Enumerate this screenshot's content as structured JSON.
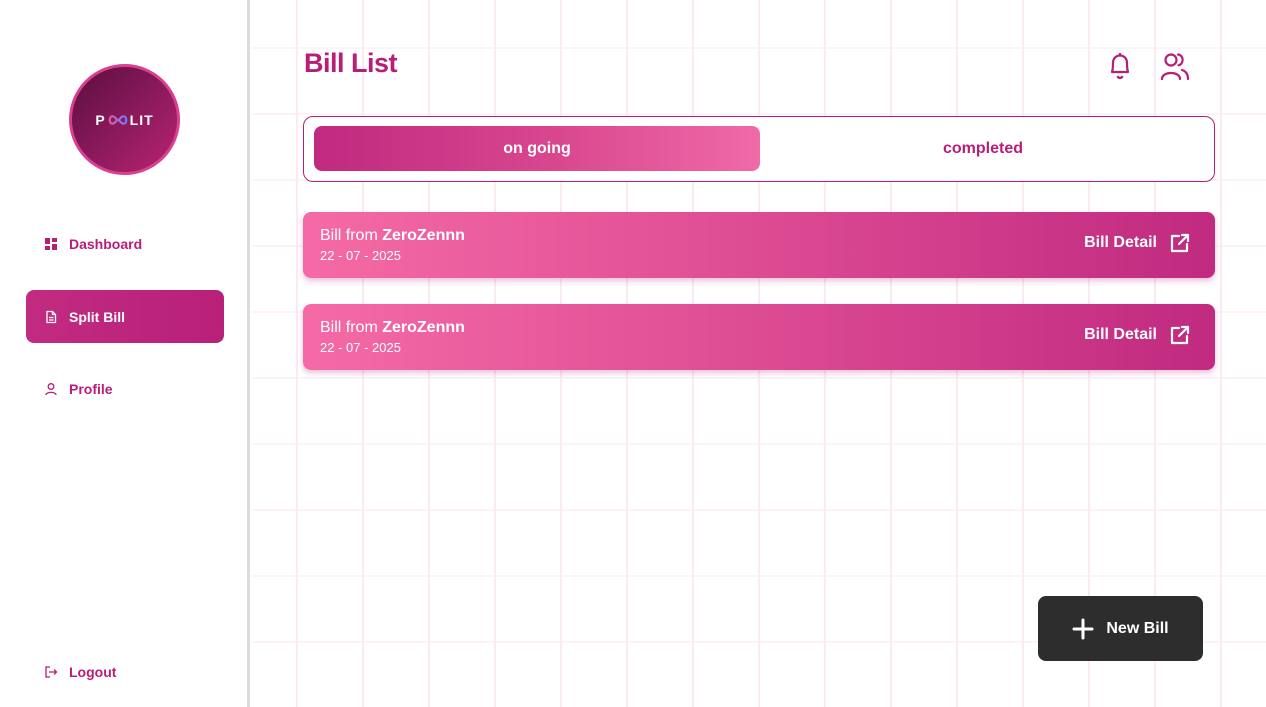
{
  "app": {
    "logo_text_left": "P",
    "logo_text_right": "LIT"
  },
  "sidebar": {
    "items": [
      {
        "label": "Dashboard",
        "icon": "dashboard-grid-icon",
        "active": false
      },
      {
        "label": "Split Bill",
        "icon": "document-icon",
        "active": true
      },
      {
        "label": "Profile",
        "icon": "user-icon",
        "active": false
      }
    ],
    "logout_label": "Logout",
    "logout_icon": "logout-icon"
  },
  "header": {
    "title": "Bill List",
    "icons": [
      "bell-icon",
      "users-icon"
    ]
  },
  "tabs": [
    {
      "label": "on going",
      "active": true
    },
    {
      "label": "completed",
      "active": false
    }
  ],
  "bills": [
    {
      "prefix": "Bill from",
      "name": "ZeroZennn",
      "date": "22 - 07 - 2025",
      "action": "Bill Detail"
    },
    {
      "prefix": "Bill from",
      "name": "ZeroZennn",
      "date": "22 - 07 - 2025",
      "action": "Bill Detail"
    }
  ],
  "new_bill_label": "New Bill",
  "colors": {
    "accent": "#b81d78",
    "accent_light": "#f06aa8",
    "dark_button": "#2d2d2d"
  }
}
